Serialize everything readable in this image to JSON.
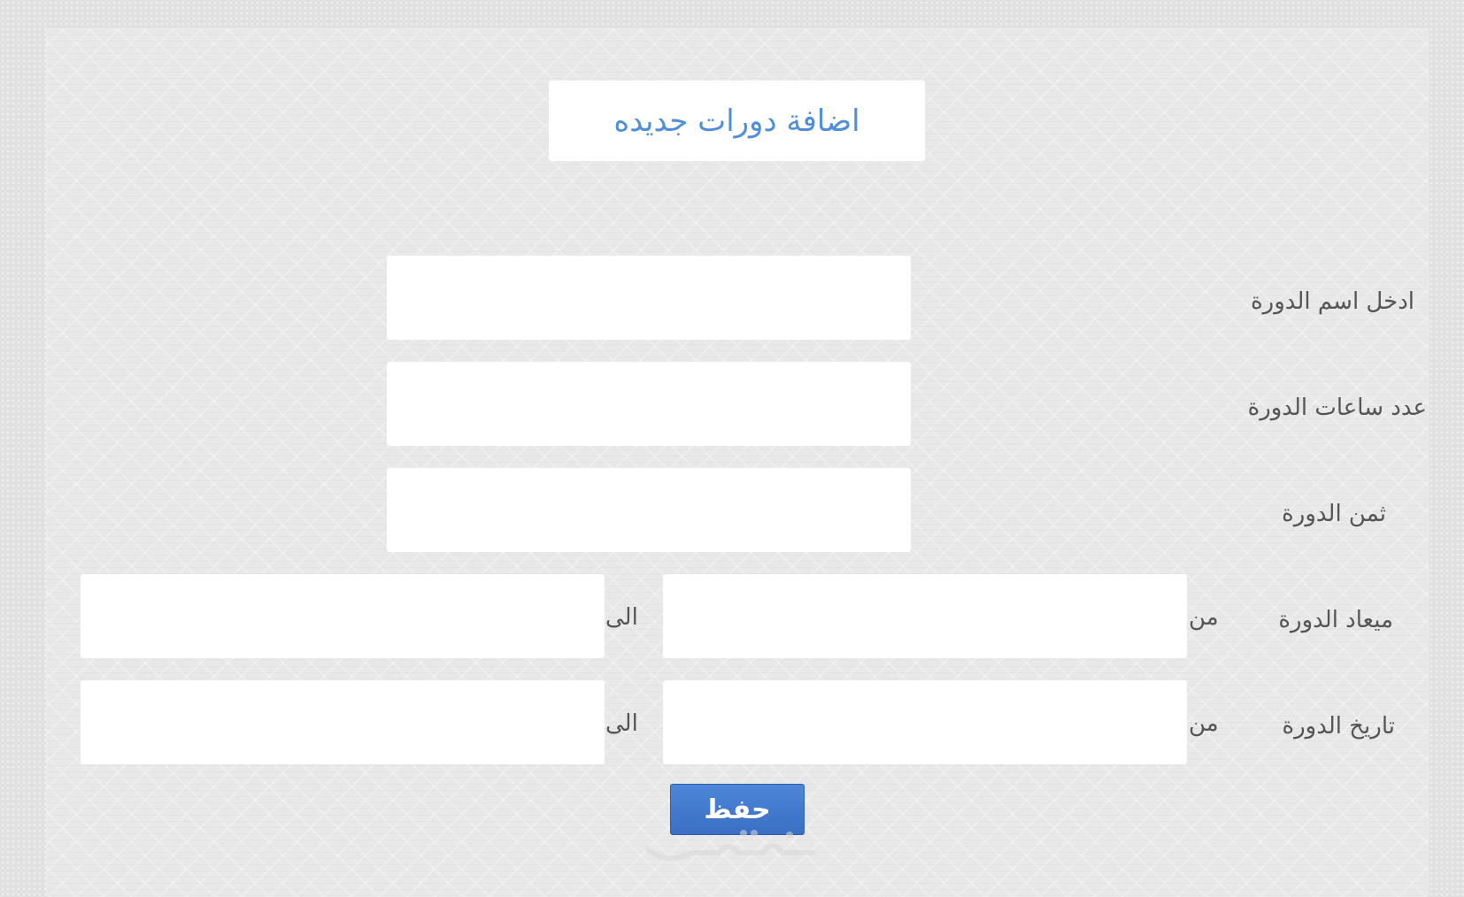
{
  "form": {
    "title": "اضافة دورات جديده",
    "course_name_label": "ادخل اسم الدورة",
    "course_hours_label": "عدد ساعات الدورة",
    "course_price_label": "ثمن الدورة",
    "course_time_label": "ميعاد الدورة",
    "course_date_label": "تاريخ الدورة",
    "from_label": "من",
    "to_label": "الى",
    "save_label": "حفظ"
  },
  "fields": {
    "course_name": "",
    "course_hours": "",
    "course_price": "",
    "time_from": "",
    "time_to": "",
    "date_from": "",
    "date_to": ""
  },
  "colors": {
    "title_text": "#4f8fda",
    "button": "#3f78cc",
    "background": "#e1e1e1"
  },
  "watermark": {
    "icon": "site-logo-watermark"
  }
}
